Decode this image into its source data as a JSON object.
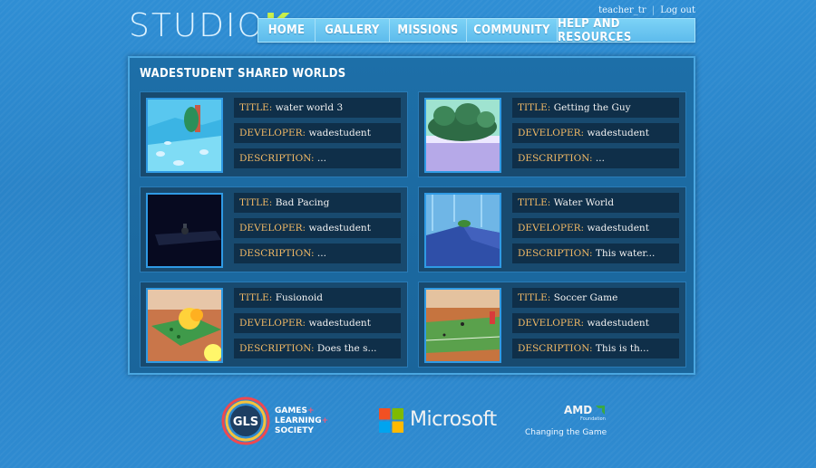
{
  "header": {
    "logo_main": "STUDIO",
    "logo_accent": "K",
    "username": "teacher_tr",
    "separator": "|",
    "logout": "Log out"
  },
  "nav": [
    "HOME",
    "GALLERY",
    "MISSIONS",
    "COMMUNITY",
    "HELP AND RESOURCES"
  ],
  "panel": {
    "title": "WADESTUDENT SHARED WORLDS",
    "labels": {
      "title": "TITLE:",
      "developer": "DEVELOPER:",
      "description": "DESCRIPTION:"
    },
    "worlds": [
      {
        "title": "water world 3",
        "developer": "wadestudent",
        "description": "...",
        "thumb": "water-world-3-thumbnail"
      },
      {
        "title": "Getting the Guy",
        "developer": "wadestudent",
        "description": "...",
        "thumb": "getting-the-guy-thumbnail"
      },
      {
        "title": "Bad Pacing",
        "developer": "wadestudent",
        "description": "...",
        "thumb": "bad-pacing-thumbnail"
      },
      {
        "title": "Water World",
        "developer": "wadestudent",
        "description": "This water...",
        "thumb": "water-world-thumbnail"
      },
      {
        "title": "Fusionoid",
        "developer": "wadestudent",
        "description": "Does the s...",
        "thumb": "fusionoid-thumbnail"
      },
      {
        "title": "Soccer Game",
        "developer": "wadestudent",
        "description": "This is th...",
        "thumb": "soccer-game-thumbnail"
      }
    ]
  },
  "footer": {
    "gls_badge": "GLS",
    "gls_line1": "GAMES",
    "gls_line2": "LEARNING",
    "gls_line3": "SOCIETY",
    "ms_word": "Microsoft",
    "amd_word": "AMD",
    "amd_sub": "Foundation",
    "amd_tag": "Changing the Game"
  },
  "colors": {
    "background": "#2e8ad0",
    "panel": "#1a659b",
    "field_bg": "#0f2f49",
    "label_orange": "#f0b865",
    "logo_accent": "#c9ef4a"
  }
}
